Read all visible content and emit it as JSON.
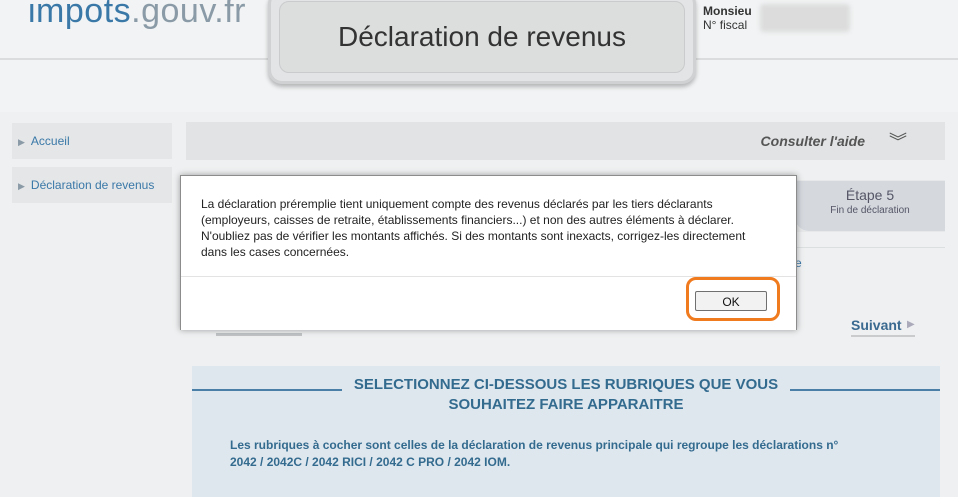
{
  "header": {
    "logo_part1": "impots",
    "logo_part2": ".gouv.fr",
    "title": "Déclaration de revenus",
    "user_name_label": "Monsieu",
    "fiscal_label": "N° fiscal"
  },
  "sidebar": {
    "items": [
      {
        "label": "Accueil"
      },
      {
        "label": "Déclaration de revenus"
      }
    ]
  },
  "help": {
    "label": "Consulter l'aide"
  },
  "steps": {
    "step5_title": "Étape 5",
    "step5_sub": "Fin de déclaration"
  },
  "partial_link": "e",
  "navigation": {
    "next_label": "Suivant"
  },
  "section": {
    "title": "SELECTIONNEZ CI-DESSOUS LES RUBRIQUES QUE VOUS SOUHAITEZ FAIRE APPARAITRE",
    "description": "Les rubriques à cocher sont celles de la déclaration de revenus principale qui regroupe les déclarations n° 2042 / 2042C / 2042 RICI / 2042 C PRO / 2042 IOM."
  },
  "dialog": {
    "message": "La déclaration préremplie tient uniquement compte des revenus déclarés par les tiers déclarants (employeurs, caisses de retraite, établissements financiers...) et non des autres éléments à déclarer. N'oubliez pas de vérifier les montants affichés. Si des montants sont inexacts, corrigez-les directement dans les cases concernées.",
    "ok_label": "OK"
  },
  "colors": {
    "brand_blue": "#3a78a8",
    "section_text": "#336b8f",
    "highlight": "#f07a1e"
  }
}
